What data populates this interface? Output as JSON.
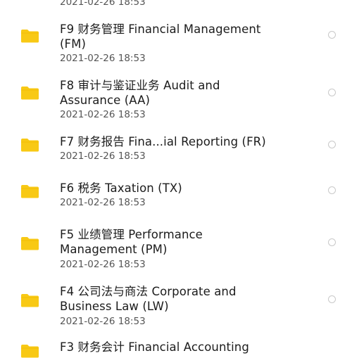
{
  "files": [
    {
      "name": "",
      "date": "2021-02-26 18:53"
    },
    {
      "name": "F9 财务管理 Financial Management\n(FM)",
      "date": "2021-02-26 18:53"
    },
    {
      "name": "F8 审计与鉴证业务 Audit and\nAssurance (AA)",
      "date": "2021-02-26 18:53"
    },
    {
      "name": "F7 财务报告 Fina...ial Reporting (FR)",
      "date": "2021-02-26 18:53"
    },
    {
      "name": "F6 税务 Taxation (TX)",
      "date": "2021-02-26 18:53"
    },
    {
      "name": "F5 业绩管理 Performance\nManagement (PM)",
      "date": "2021-02-26 18:53"
    },
    {
      "name": "F4 公司法与商法 Corporate and\nBusiness Law (LW)",
      "date": "2021-02-26 18:53"
    },
    {
      "name": "F3 财务会计 Financial Accounting",
      "date": ""
    }
  ],
  "icons": {
    "folder": "folder-icon",
    "select": "radio-circle-icon"
  },
  "colors": {
    "folder": "#f8c915",
    "folder_tab": "#f0b800",
    "text": "#1c1c1c",
    "date": "#555555",
    "radio_border": "#c9c9c9"
  }
}
